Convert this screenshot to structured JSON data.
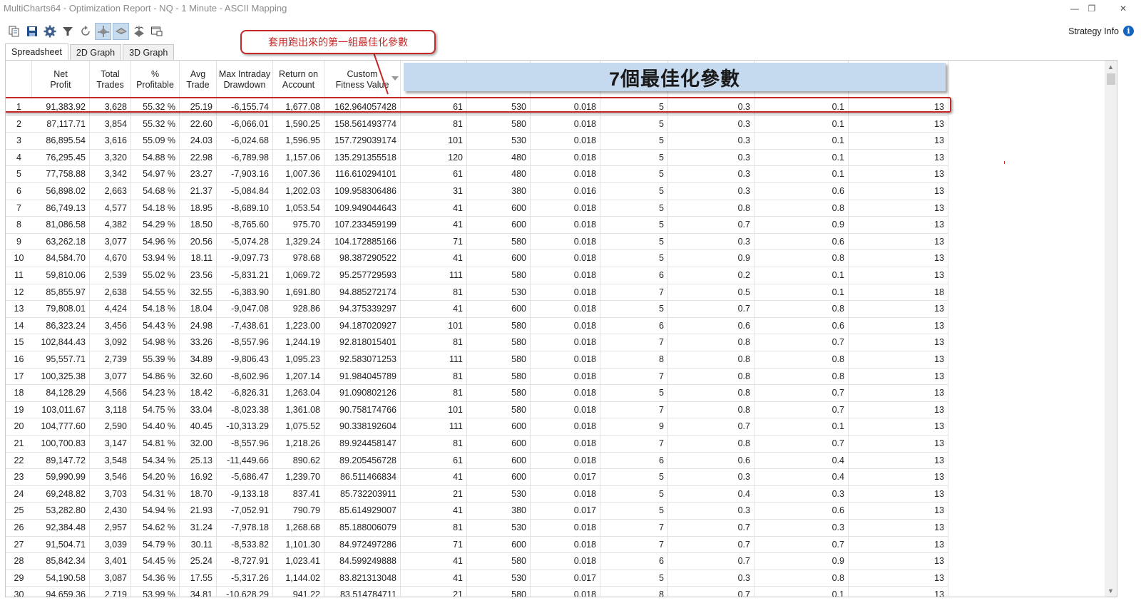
{
  "window": {
    "title": "MultiCharts64 - Optimization Report - NQ - 1 Minute - ASCII Mapping",
    "minimize": "—",
    "restore": "❐",
    "close": "✕"
  },
  "toolbar": {
    "icons": [
      "copy-icon",
      "save-icon",
      "gear-icon",
      "filter-icon",
      "refresh-icon",
      "graph-2d-icon",
      "graph-3d-icon",
      "optimize-icon",
      "window-icon"
    ]
  },
  "strategy_info": {
    "label": "Strategy Info",
    "icon": "i"
  },
  "tabs": [
    {
      "label": "Spreadsheet",
      "active": true
    },
    {
      "label": "2D Graph",
      "active": false
    },
    {
      "label": "3D Graph",
      "active": false
    }
  ],
  "annotations": {
    "callout": "套用跑出來的第一組最佳化參數",
    "banner": "7個最佳化參數"
  },
  "columns": [
    {
      "label": ""
    },
    {
      "label": "Net\nProfit"
    },
    {
      "label": "Total\nTrades"
    },
    {
      "label": "%\nProfitable"
    },
    {
      "label": "Avg\nTrade"
    },
    {
      "label": "Max Intraday\nDrawdown"
    },
    {
      "label": "Return on\nAccount"
    },
    {
      "label": "Custom\nFitness Value"
    },
    {
      "label": ""
    },
    {
      "label": ""
    },
    {
      "label": ""
    },
    {
      "label": ""
    },
    {
      "label": ""
    },
    {
      "label": ""
    },
    {
      "label": ""
    }
  ],
  "rows": [
    [
      "1",
      "91,383.92",
      "3,628",
      "55.32 %",
      "25.19",
      "-6,155.74",
      "1,677.08",
      "162.964057428",
      "61",
      "530",
      "0.018",
      "5",
      "0.3",
      "0.1",
      "13"
    ],
    [
      "2",
      "87,117.71",
      "3,854",
      "55.32 %",
      "22.60",
      "-6,066.01",
      "1,590.25",
      "158.561493774",
      "81",
      "580",
      "0.018",
      "5",
      "0.3",
      "0.1",
      "13"
    ],
    [
      "3",
      "86,895.54",
      "3,616",
      "55.09 %",
      "24.03",
      "-6,024.68",
      "1,596.95",
      "157.729039174",
      "101",
      "530",
      "0.018",
      "5",
      "0.3",
      "0.1",
      "13"
    ],
    [
      "4",
      "76,295.45",
      "3,320",
      "54.88 %",
      "22.98",
      "-6,789.98",
      "1,157.06",
      "135.291355518",
      "120",
      "480",
      "0.018",
      "5",
      "0.3",
      "0.1",
      "13"
    ],
    [
      "5",
      "77,758.88",
      "3,342",
      "54.97 %",
      "23.27",
      "-7,903.16",
      "1,007.36",
      "116.610294101",
      "61",
      "480",
      "0.018",
      "5",
      "0.3",
      "0.1",
      "13"
    ],
    [
      "6",
      "56,898.02",
      "2,663",
      "54.68 %",
      "21.37",
      "-5,084.84",
      "1,202.03",
      "109.958306486",
      "31",
      "380",
      "0.016",
      "5",
      "0.3",
      "0.6",
      "13"
    ],
    [
      "7",
      "86,749.13",
      "4,577",
      "54.18 %",
      "18.95",
      "-8,689.10",
      "1,053.54",
      "109.949044643",
      "41",
      "600",
      "0.018",
      "5",
      "0.8",
      "0.8",
      "13"
    ],
    [
      "8",
      "81,086.58",
      "4,382",
      "54.29 %",
      "18.50",
      "-8,765.60",
      "975.70",
      "107.233459199",
      "41",
      "600",
      "0.018",
      "5",
      "0.7",
      "0.9",
      "13"
    ],
    [
      "9",
      "63,262.18",
      "3,077",
      "54.96 %",
      "20.56",
      "-5,074.28",
      "1,329.24",
      "104.172885166",
      "71",
      "580",
      "0.018",
      "5",
      "0.3",
      "0.6",
      "13"
    ],
    [
      "10",
      "84,584.70",
      "4,670",
      "53.94 %",
      "18.11",
      "-9,097.73",
      "978.68",
      "98.387290522",
      "41",
      "600",
      "0.018",
      "5",
      "0.9",
      "0.8",
      "13"
    ],
    [
      "11",
      "59,810.06",
      "2,539",
      "55.02 %",
      "23.56",
      "-5,831.21",
      "1,069.72",
      "95.257729593",
      "111",
      "580",
      "0.018",
      "6",
      "0.2",
      "0.1",
      "13"
    ],
    [
      "12",
      "85,855.97",
      "2,638",
      "54.55 %",
      "32.55",
      "-6,383.90",
      "1,691.80",
      "94.885272174",
      "81",
      "530",
      "0.018",
      "7",
      "0.5",
      "0.1",
      "18"
    ],
    [
      "13",
      "79,808.01",
      "4,424",
      "54.18 %",
      "18.04",
      "-9,047.08",
      "928.86",
      "94.375339297",
      "41",
      "600",
      "0.018",
      "5",
      "0.7",
      "0.8",
      "13"
    ],
    [
      "14",
      "86,323.24",
      "3,456",
      "54.43 %",
      "24.98",
      "-7,438.61",
      "1,223.00",
      "94.187020927",
      "101",
      "580",
      "0.018",
      "6",
      "0.6",
      "0.6",
      "13"
    ],
    [
      "15",
      "102,844.43",
      "3,092",
      "54.98 %",
      "33.26",
      "-8,557.96",
      "1,244.19",
      "92.818015401",
      "81",
      "580",
      "0.018",
      "7",
      "0.8",
      "0.7",
      "13"
    ],
    [
      "16",
      "95,557.71",
      "2,739",
      "55.39 %",
      "34.89",
      "-9,806.43",
      "1,095.23",
      "92.583071253",
      "111",
      "580",
      "0.018",
      "8",
      "0.8",
      "0.8",
      "13"
    ],
    [
      "17",
      "100,325.38",
      "3,077",
      "54.86 %",
      "32.60",
      "-8,602.96",
      "1,207.14",
      "91.984045789",
      "81",
      "580",
      "0.018",
      "7",
      "0.8",
      "0.8",
      "13"
    ],
    [
      "18",
      "84,128.29",
      "4,566",
      "54.23 %",
      "18.42",
      "-6,826.31",
      "1,263.04",
      "91.090802126",
      "81",
      "580",
      "0.018",
      "5",
      "0.8",
      "0.7",
      "13"
    ],
    [
      "19",
      "103,011.67",
      "3,118",
      "54.75 %",
      "33.04",
      "-8,023.38",
      "1,361.08",
      "90.758174766",
      "101",
      "580",
      "0.018",
      "7",
      "0.8",
      "0.7",
      "13"
    ],
    [
      "20",
      "104,777.60",
      "2,590",
      "54.40 %",
      "40.45",
      "-10,313.29",
      "1,075.52",
      "90.338192604",
      "111",
      "600",
      "0.018",
      "9",
      "0.7",
      "0.1",
      "13"
    ],
    [
      "21",
      "100,700.83",
      "3,147",
      "54.81 %",
      "32.00",
      "-8,557.96",
      "1,218.26",
      "89.924458147",
      "81",
      "600",
      "0.018",
      "7",
      "0.8",
      "0.7",
      "13"
    ],
    [
      "22",
      "89,147.72",
      "3,548",
      "54.34 %",
      "25.13",
      "-11,449.66",
      "890.62",
      "89.205456728",
      "61",
      "600",
      "0.018",
      "6",
      "0.6",
      "0.4",
      "13"
    ],
    [
      "23",
      "59,990.99",
      "3,546",
      "54.20 %",
      "16.92",
      "-5,686.47",
      "1,239.70",
      "86.511466834",
      "41",
      "600",
      "0.017",
      "5",
      "0.3",
      "0.4",
      "13"
    ],
    [
      "24",
      "69,248.82",
      "3,703",
      "54.31 %",
      "18.70",
      "-9,133.18",
      "837.41",
      "85.732203911",
      "21",
      "530",
      "0.018",
      "5",
      "0.4",
      "0.3",
      "13"
    ],
    [
      "25",
      "53,282.80",
      "2,430",
      "54.94 %",
      "21.93",
      "-7,052.91",
      "790.79",
      "85.614929007",
      "41",
      "380",
      "0.017",
      "5",
      "0.3",
      "0.6",
      "13"
    ],
    [
      "26",
      "92,384.48",
      "2,957",
      "54.62 %",
      "31.24",
      "-7,978.18",
      "1,268.68",
      "85.188006079",
      "81",
      "530",
      "0.018",
      "7",
      "0.7",
      "0.3",
      "13"
    ],
    [
      "27",
      "91,504.71",
      "3,039",
      "54.79 %",
      "30.11",
      "-8,533.82",
      "1,101.30",
      "84.972497286",
      "71",
      "600",
      "0.018",
      "7",
      "0.7",
      "0.7",
      "13"
    ],
    [
      "28",
      "85,842.34",
      "3,401",
      "54.45 %",
      "25.24",
      "-8,727.91",
      "1,023.41",
      "84.599249888",
      "41",
      "580",
      "0.018",
      "6",
      "0.7",
      "0.9",
      "13"
    ],
    [
      "29",
      "54,190.58",
      "3,087",
      "54.36 %",
      "17.55",
      "-5,317.26",
      "1,144.02",
      "83.821313048",
      "41",
      "530",
      "0.017",
      "5",
      "0.3",
      "0.8",
      "13"
    ],
    [
      "30",
      "94,659.36",
      "2,719",
      "53.99 %",
      "34.81",
      "-10,628.29",
      "941.22",
      "83.514784711",
      "21",
      "580",
      "0.018",
      "8",
      "0.7",
      "0.1",
      "13"
    ]
  ]
}
